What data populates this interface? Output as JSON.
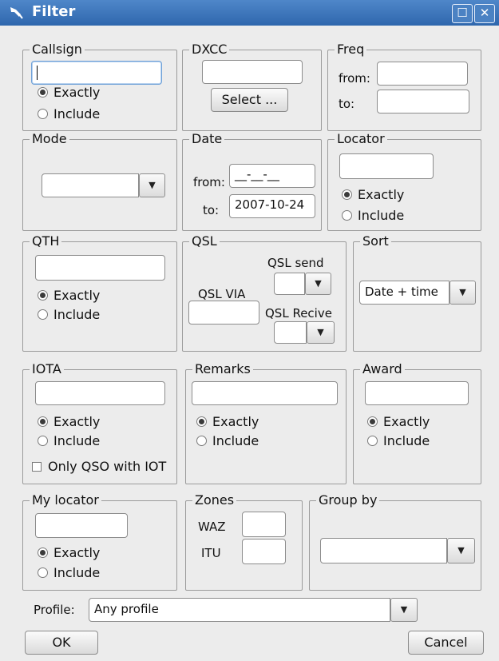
{
  "window": {
    "title": "Filter",
    "icon": "pen-icon",
    "maximize_icon": "maximize-icon",
    "close_icon": "close-icon"
  },
  "callsign": {
    "legend": "Callsign",
    "value": "",
    "exactly": "Exactly",
    "include": "Include",
    "selected": "exactly"
  },
  "dxcc": {
    "legend": "DXCC",
    "value": "",
    "select_label": "Select ..."
  },
  "freq": {
    "legend": "Freq",
    "from_label": "from:",
    "to_label": "to:",
    "from_value": "",
    "to_value": ""
  },
  "mode": {
    "legend": "Mode",
    "value": ""
  },
  "date": {
    "legend": "Date",
    "from_label": "from:",
    "from_value": "__-__-__",
    "to_label": "to:",
    "to_value": "2007-10-24"
  },
  "locator": {
    "legend": "Locator",
    "value": "",
    "exactly": "Exactly",
    "include": "Include",
    "selected": "exactly"
  },
  "qth": {
    "legend": "QTH",
    "value": "",
    "exactly": "Exactly",
    "include": "Include",
    "selected": "exactly"
  },
  "qsl": {
    "legend": "QSL",
    "via_label": "QSL VIA",
    "via_value": "",
    "send_label": "QSL send",
    "send_value": "",
    "receive_label": "QSL Recive",
    "receive_value": ""
  },
  "sort": {
    "legend": "Sort",
    "value": "Date + time"
  },
  "iota": {
    "legend": "IOTA",
    "value": "",
    "exactly": "Exactly",
    "include": "Include",
    "selected": "exactly",
    "only_qso_label": "Only QSO with IOT",
    "only_qso_checked": false
  },
  "remarks": {
    "legend": "Remarks",
    "value": "",
    "exactly": "Exactly",
    "include": "Include",
    "selected": "exactly"
  },
  "award": {
    "legend": "Award",
    "value": "",
    "exactly": "Exactly",
    "include": "Include",
    "selected": "exactly"
  },
  "my_locator": {
    "legend": "My locator",
    "value": "",
    "exactly": "Exactly",
    "include": "Include",
    "selected": "exactly"
  },
  "zones": {
    "legend": "Zones",
    "waz_label": "WAZ",
    "waz_value": "",
    "itu_label": "ITU",
    "itu_value": ""
  },
  "group_by": {
    "legend": "Group by",
    "value": ""
  },
  "profile": {
    "label": "Profile:",
    "value": "Any profile"
  },
  "buttons": {
    "ok": "OK",
    "cancel": "Cancel"
  },
  "icons": {
    "dropdown": "chevron-down-icon"
  },
  "colors": {
    "titlebar": "#3a74ba",
    "window_bg": "#ececec",
    "field_border": "#8c8c8c",
    "focus_border": "#6fa1d8"
  }
}
